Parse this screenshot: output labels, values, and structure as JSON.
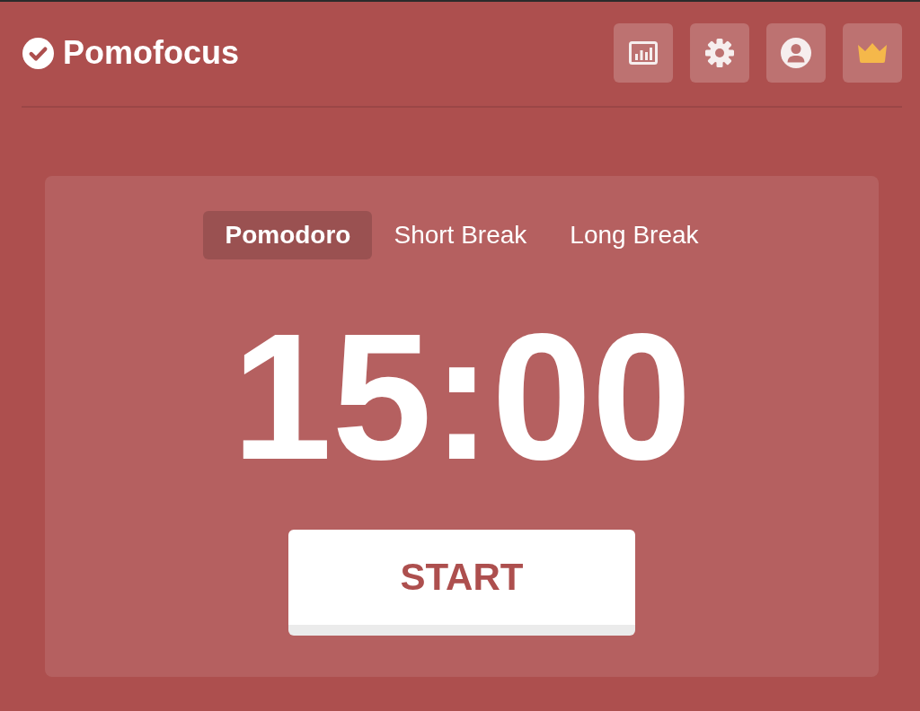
{
  "header": {
    "logo": "Pomofocus"
  },
  "timer": {
    "tabs": [
      {
        "label": "Pomodoro",
        "selected": true
      },
      {
        "label": "Short Break",
        "selected": false
      },
      {
        "label": "Long Break",
        "selected": false
      }
    ],
    "time": "15:00",
    "start_button": "START"
  }
}
